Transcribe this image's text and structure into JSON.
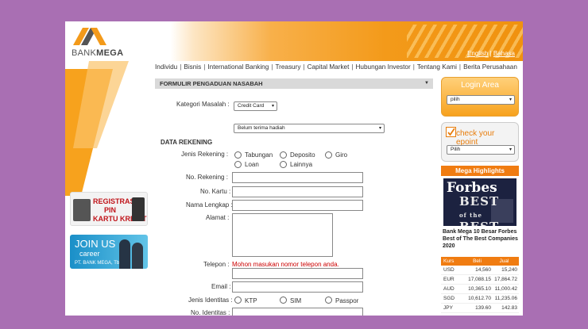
{
  "header": {
    "brand_a": "BANK",
    "brand_b": "MEGA",
    "lang_english": "English",
    "lang_sep": "|",
    "lang_bahasa": "Bahasa"
  },
  "nav": [
    "Individu",
    "Bisnis",
    "International Banking",
    "Treasury",
    "Capital Market",
    "Hubungan Investor",
    "Tentang Kami",
    "Berita Perusahaan"
  ],
  "form": {
    "title": "FORMULIR PENGADUAN NASABAH",
    "kategori_label": "Kategori Masalah :",
    "kategori_value": "Credit Card",
    "sub_value": "Belum terima hadiah",
    "section_rekening": "DATA REKENING",
    "jenis_rekening_label": "Jenis Rekening :",
    "jenis_rekening_options": [
      "Tabungan",
      "Deposito",
      "Giro",
      "Loan",
      "Lainnya"
    ],
    "no_rekening_label": "No. Rekening :",
    "no_kartu_label": "No. Kartu :",
    "nama_label": "Nama Lengkap :",
    "alamat_label": "Alamat :",
    "telepon_label": "Telepon :",
    "telepon_error": "Mohon masukan nomor telepon anda.",
    "email_label": "Email :",
    "jenis_identitas_label": "Jenis Identitas :",
    "identitas_options": [
      "KTP",
      "SIM",
      "Passpor"
    ],
    "no_identitas_label": "No. Identitas :"
  },
  "sidebar": {
    "login_title": "Login Area",
    "login_select": "pilih",
    "epoint_title": "check your epoint",
    "epoint_select": "Pilih",
    "highlights_title": "Mega Highlights",
    "forbes_logo": "Forbes",
    "forbes_best": "BEST",
    "forbes_of": "of the",
    "forbes_best2": "BEST",
    "forbes_caption": "Bank Mega 10 Besar Forbes Best of The Best Companies 2020"
  },
  "kurs": {
    "headers": [
      "Kurs",
      "Beli",
      "Jual"
    ],
    "rows": [
      [
        "USD",
        "14,560",
        "15,240"
      ],
      [
        "EUR",
        "17,088.15",
        "17,864.72"
      ],
      [
        "AUD",
        "10,365.10",
        "11,000.42"
      ],
      [
        "SGD",
        "10,612.70",
        "11,235.06"
      ],
      [
        "JPY",
        "139.60",
        "142.83"
      ]
    ]
  },
  "promos": {
    "kartu_line1": "REGISTRASI",
    "kartu_line2": "PIN",
    "kartu_line3": "KARTU KREDIT",
    "join_line1": "JOIN US",
    "join_line2": "career",
    "join_line3": "PT. BANK MEGA, Tbk"
  },
  "colors": {
    "accent": "#f39a1a",
    "background": "#a96fb3",
    "error": "#cc0000"
  }
}
